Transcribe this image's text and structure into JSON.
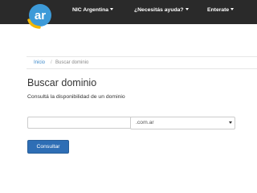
{
  "navbar": {
    "logo_text": "ar",
    "items": [
      {
        "label": "NIC Argentina"
      },
      {
        "label": "¿Necesitás ayuda?"
      },
      {
        "label": "Enterate"
      }
    ]
  },
  "breadcrumb": {
    "home": "Inicio",
    "separator": "/",
    "current": "Buscar dominio"
  },
  "main": {
    "title": "Buscar dominio",
    "subtitle": "Consultá la disponibilidad de un dominio"
  },
  "search": {
    "domain_value": "",
    "tld_selected": ".com.ar",
    "submit_label": "Consultar"
  },
  "colors": {
    "navbar_bg": "#2a2a2a",
    "logo_blue": "#3d9ad8",
    "logo_yellow": "#f2b705",
    "link": "#3a87c9",
    "button": "#2e6eb5"
  }
}
